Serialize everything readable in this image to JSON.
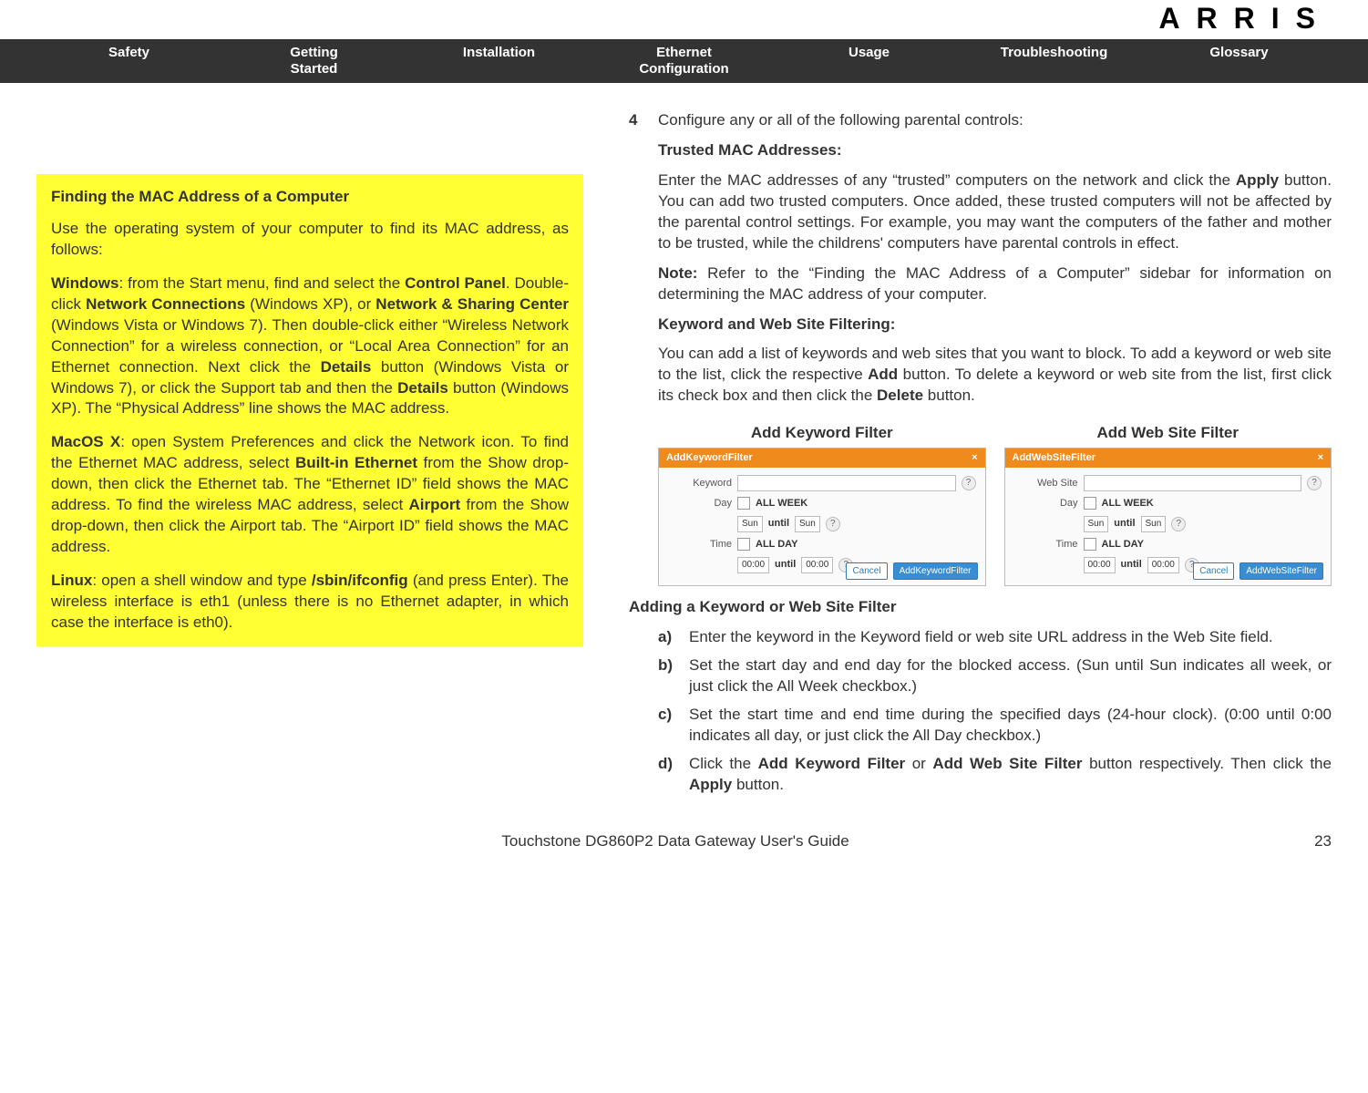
{
  "brand": "ARRIS",
  "nav": {
    "safety": "Safety",
    "getting_started": "Getting\nStarted",
    "installation": "Installation",
    "ethernet_config": "Ethernet\nConfiguration",
    "usage": "Usage",
    "troubleshooting": "Troubleshooting",
    "glossary": "Glossary"
  },
  "sidebar": {
    "title": "Finding the MAC Address of a Computer",
    "intro": "Use the operating system of your computer to find its MAC address, as follows:",
    "windows_label": "Windows",
    "windows_1": ": from the Start menu, find and select the ",
    "windows_cp": "Control Panel",
    "windows_2": ". Double-click ",
    "windows_nc": "Network Connections",
    "windows_3": " (Windows XP), or ",
    "windows_nsc": "Network & Sharing Center",
    "windows_4": " (Windows Vista or Windows 7). Then double-click either “Wireless Network Connection” for a wireless connection, or “Local Area Connection” for an Ethernet connection. Next click the ",
    "windows_details1": "Details",
    "windows_5": " button (Windows Vista or Windows 7), or click the Support tab and then the ",
    "windows_details2": "Details",
    "windows_6": " button (Windows XP). The “Physical Address” line shows the MAC address.",
    "mac_label": "MacOS X",
    "mac_1": ": open System Preferences and click the Network icon. To find the Ethernet MAC address, select ",
    "mac_bie": "Built-in Ethernet",
    "mac_2": " from the Show drop-down, then click the Ethernet tab. The “Ethernet ID” field shows the MAC address. To find the wireless MAC address, select ",
    "mac_airport": "Airport",
    "mac_3": " from the Show drop-down, then click the Airport tab. The “Airport ID” field shows the MAC address.",
    "linux_label": "Linux",
    "linux_1": ": open a shell window and type ",
    "linux_cmd": "/sbin/ifconfig",
    "linux_2": " (and press Enter). The wireless interface is eth1 (unless there is no Ethernet adapter, in which case the interface is eth0)."
  },
  "main": {
    "step4_num": "4",
    "step4_text": "Configure any or all of the following parental controls:",
    "trusted_head": "Trusted MAC Addresses:",
    "trusted_1": "Enter the MAC addresses of any “trusted” computers on the network and click the ",
    "apply": "Apply",
    "trusted_2": " button. You can add two trusted computers. Once added, these trusted computers will not be affected by the parental control settings. For example, you may want the computers of the father and mother to be trusted, while the childrens' computers have parental controls in effect.",
    "note_label": "Note:",
    "note_text": " Refer to the “Finding the MAC Address of a Computer” sidebar for information on determining the MAC address of your computer.",
    "kw_head": "Keyword and Web Site Filtering:",
    "kw_1": "You can add a list of keywords and web sites that you want to block. To add a keyword or web site to the list, click the respective ",
    "add": "Add",
    "kw_2": " button. To delete a keyword or web site from the list, first click its check box and then click the ",
    "delete": "Delete",
    "kw_3": " button.",
    "fig1_caption": "Add Keyword Filter",
    "fig2_caption": "Add Web Site Filter",
    "dialog1": {
      "title": "AddKeywordFilter",
      "field1": "Keyword",
      "day": "Day",
      "allweek": "ALL WEEK",
      "sun": "Sun",
      "until": "until",
      "time": "Time",
      "allday": "ALL DAY",
      "t0": "00:00",
      "cancel": "Cancel",
      "submit": "AddKeywordFilter"
    },
    "dialog2": {
      "title": "AddWebSiteFilter",
      "field1": "Web Site",
      "day": "Day",
      "allweek": "ALL WEEK",
      "sun": "Sun",
      "until": "until",
      "time": "Time",
      "allday": "ALL DAY",
      "t0": "00:00",
      "cancel": "Cancel",
      "submit": "AddWebSiteFilter"
    },
    "adding_head": "Adding a Keyword or Web Site Filter",
    "a_lbl": "a)",
    "a_txt": "Enter the keyword in the Keyword field or web site URL address in the Web Site field.",
    "b_lbl": "b)",
    "b_txt": "Set the start day and end day for the blocked access. (Sun until Sun indicates all week, or just click the All Week checkbox.)",
    "c_lbl": "c)",
    "c_txt": "Set the start time and end time during the specified days (24-hour clock). (0:00 until 0:00 indicates all day, or just click the All Day checkbox.)",
    "d_lbl": "d)",
    "d_1": "Click the ",
    "d_akf": "Add Keyword Filter",
    "d_or": " or ",
    "d_awsf": "Add Web Site Filter",
    "d_2": " button respectively. Then click the ",
    "d_apply": "Apply",
    "d_3": " button."
  },
  "footer": {
    "title": "Touchstone DG860P2 Data Gateway User's Guide",
    "page": "23"
  }
}
